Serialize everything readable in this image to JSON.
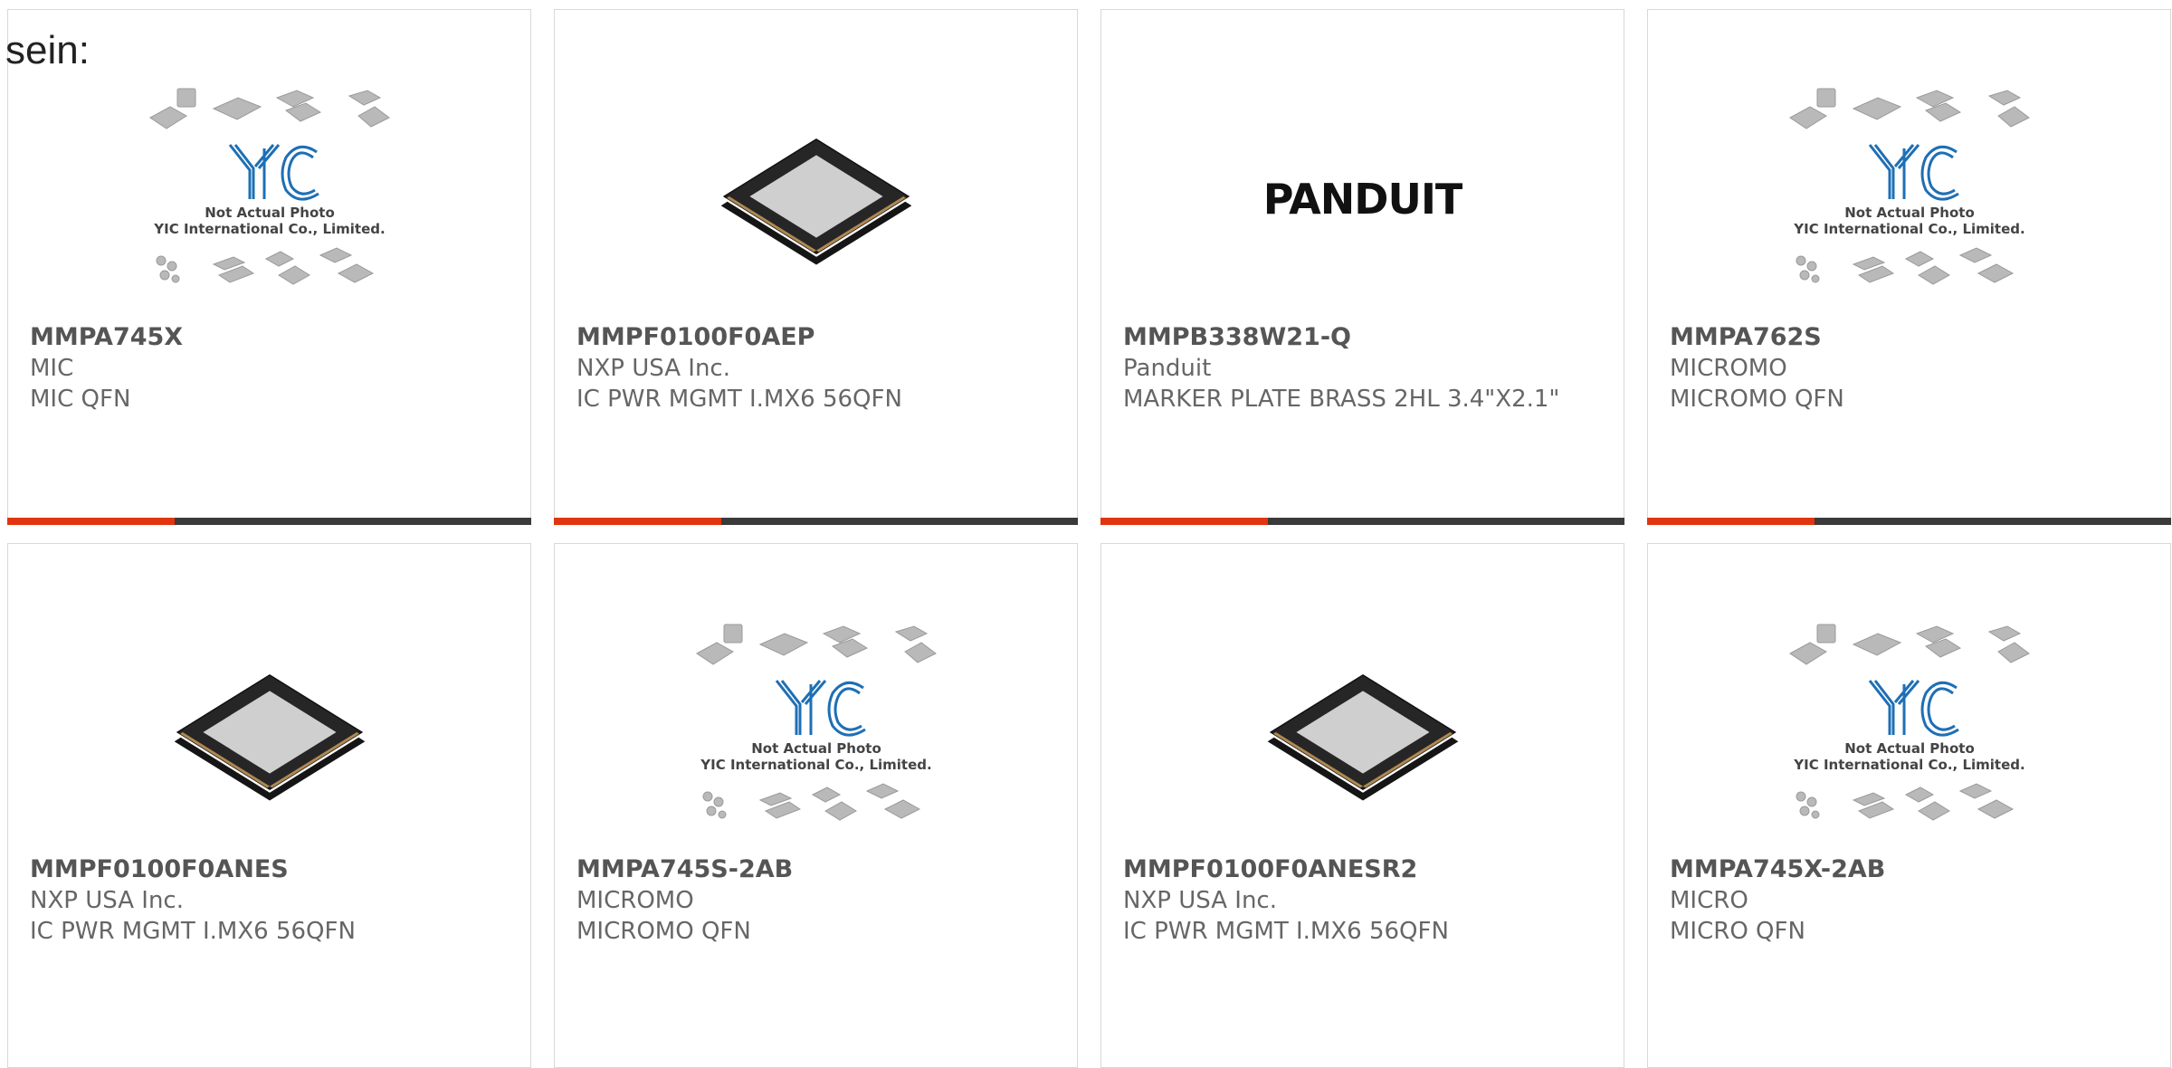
{
  "header": {
    "label": "sein:"
  },
  "colors": {
    "accent": "#e0350f",
    "bar": "#3a3a3a",
    "text_bold": "#555555",
    "text": "#666666"
  },
  "placeholder": {
    "logo": "YIC",
    "line1": "Not Actual Photo",
    "line2": "YIC International Co., Limited."
  },
  "brand_logo": "PANDUIT",
  "products": [
    {
      "part_number": "MMPA745X",
      "manufacturer": "MIC",
      "description": "MIC QFN",
      "image": "placeholder"
    },
    {
      "part_number": "MMPF0100F0AEP",
      "manufacturer": "NXP USA Inc.",
      "description": "IC PWR MGMT I.MX6 56QFN",
      "image": "qfn-chip"
    },
    {
      "part_number": "MMPB338W21-Q",
      "manufacturer": "Panduit",
      "description": "MARKER PLATE BRASS 2HL 3.4\"X2.1\"",
      "image": "panduit-logo"
    },
    {
      "part_number": "MMPA762S",
      "manufacturer": "MICROMO",
      "description": "MICROMO QFN",
      "image": "placeholder"
    },
    {
      "part_number": "MMPF0100F0ANES",
      "manufacturer": "NXP USA Inc.",
      "description": "IC PWR MGMT I.MX6 56QFN",
      "image": "qfn-chip"
    },
    {
      "part_number": "MMPA745S-2AB",
      "manufacturer": "MICROMO",
      "description": "MICROMO QFN",
      "image": "placeholder"
    },
    {
      "part_number": "MMPF0100F0ANESR2",
      "manufacturer": "NXP USA Inc.",
      "description": "IC PWR MGMT I.MX6 56QFN",
      "image": "qfn-chip"
    },
    {
      "part_number": "MMPA745X-2AB",
      "manufacturer": "MICRO",
      "description": "MICRO QFN",
      "image": "placeholder"
    }
  ]
}
